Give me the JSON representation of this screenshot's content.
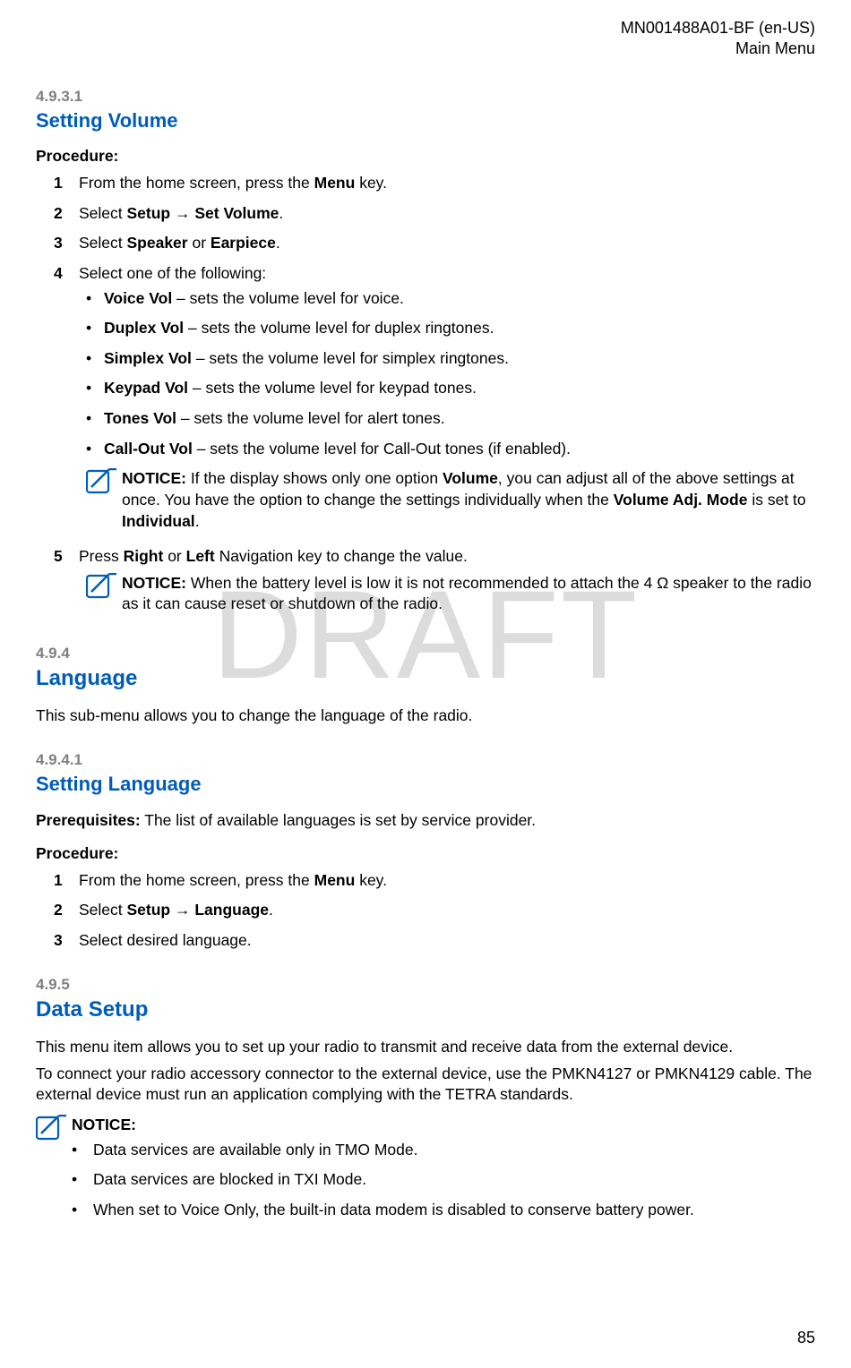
{
  "header": {
    "doc_id": "MN001488A01-BF (en-US)",
    "section": "Main Menu"
  },
  "watermark": "DRAFT",
  "sec_4931": {
    "num": "4.9.3.1",
    "title": "Setting Volume",
    "procedure_label": "Procedure:",
    "step1_num": "1",
    "step1_a": "From the home screen, press the ",
    "step1_b": "Menu",
    "step1_c": " key.",
    "step2_num": "2",
    "step2_a": "Select ",
    "step2_b": "Setup",
    "step2_c": " → ",
    "step2_d": "Set Volume",
    "step2_e": ".",
    "step3_num": "3",
    "step3_a": "Select ",
    "step3_b": "Speaker",
    "step3_c": " or ",
    "step3_d": "Earpiece",
    "step3_e": ".",
    "step4_num": "4",
    "step4_a": "Select one of the following:",
    "bul1_b": "Voice Vol",
    "bul1_t": " – sets the volume level for voice.",
    "bul2_b": "Duplex Vol",
    "bul2_t": " – sets the volume level for duplex ringtones.",
    "bul3_b": "Simplex Vol",
    "bul3_t": " – sets the volume level for simplex ringtones.",
    "bul4_b": "Keypad Vol",
    "bul4_t": " – sets the volume level for keypad tones.",
    "bul5_b": "Tones Vol",
    "bul5_t": " – sets the volume level for alert tones.",
    "bul6_b": "Call-Out Vol",
    "bul6_t": " – sets the volume level for Call-Out tones (if enabled).",
    "notice1_label": "NOTICE:",
    "notice1_a": " If the display shows only one option ",
    "notice1_b": "Volume",
    "notice1_c": ", you can adjust all of the above settings at once. You have the option to change the settings individually when the ",
    "notice1_d": "Volume Adj. Mode",
    "notice1_e": " is set to ",
    "notice1_f": "Individual",
    "notice1_g": ".",
    "step5_num": "5",
    "step5_a": "Press ",
    "step5_b": "Right",
    "step5_c": " or ",
    "step5_d": "Left",
    "step5_e": " Navigation key to change the value.",
    "notice2_label": "NOTICE:",
    "notice2_a": " When the battery level is low it is not recommended to attach the 4 Ω speaker to the radio as it can cause reset or shutdown of the radio."
  },
  "sec_494": {
    "num": "4.9.4",
    "title": "Language",
    "desc": "This sub-menu allows you to change the language of the radio."
  },
  "sec_4941": {
    "num": "4.9.4.1",
    "title": "Setting Language",
    "prereq_label": "Prerequisites:",
    "prereq_text": " The list of available languages is set by service provider.",
    "procedure_label": "Procedure:",
    "step1_num": "1",
    "step1_a": "From the home screen, press the ",
    "step1_b": "Menu",
    "step1_c": " key.",
    "step2_num": "2",
    "step2_a": "Select ",
    "step2_b": "Setup",
    "step2_c": " → ",
    "step2_d": "Language",
    "step2_e": ".",
    "step3_num": "3",
    "step3_a": "Select desired language."
  },
  "sec_495": {
    "num": "4.9.5",
    "title": "Data Setup",
    "p1": "This menu item allows you to set up your radio to transmit and receive data from the external device.",
    "p2": "To connect your radio accessory connector to the external device, use the PMKN4127 or PMKN4129 cable. The external device must run an application complying with the TETRA standards.",
    "notice_label": "NOTICE:",
    "bul1": "Data services are available only in TMO Mode.",
    "bul2": "Data services are blocked in TXI Mode.",
    "bul3": "When set to Voice Only, the built-in data modem is disabled to conserve battery power."
  },
  "footer": {
    "page": "85"
  }
}
